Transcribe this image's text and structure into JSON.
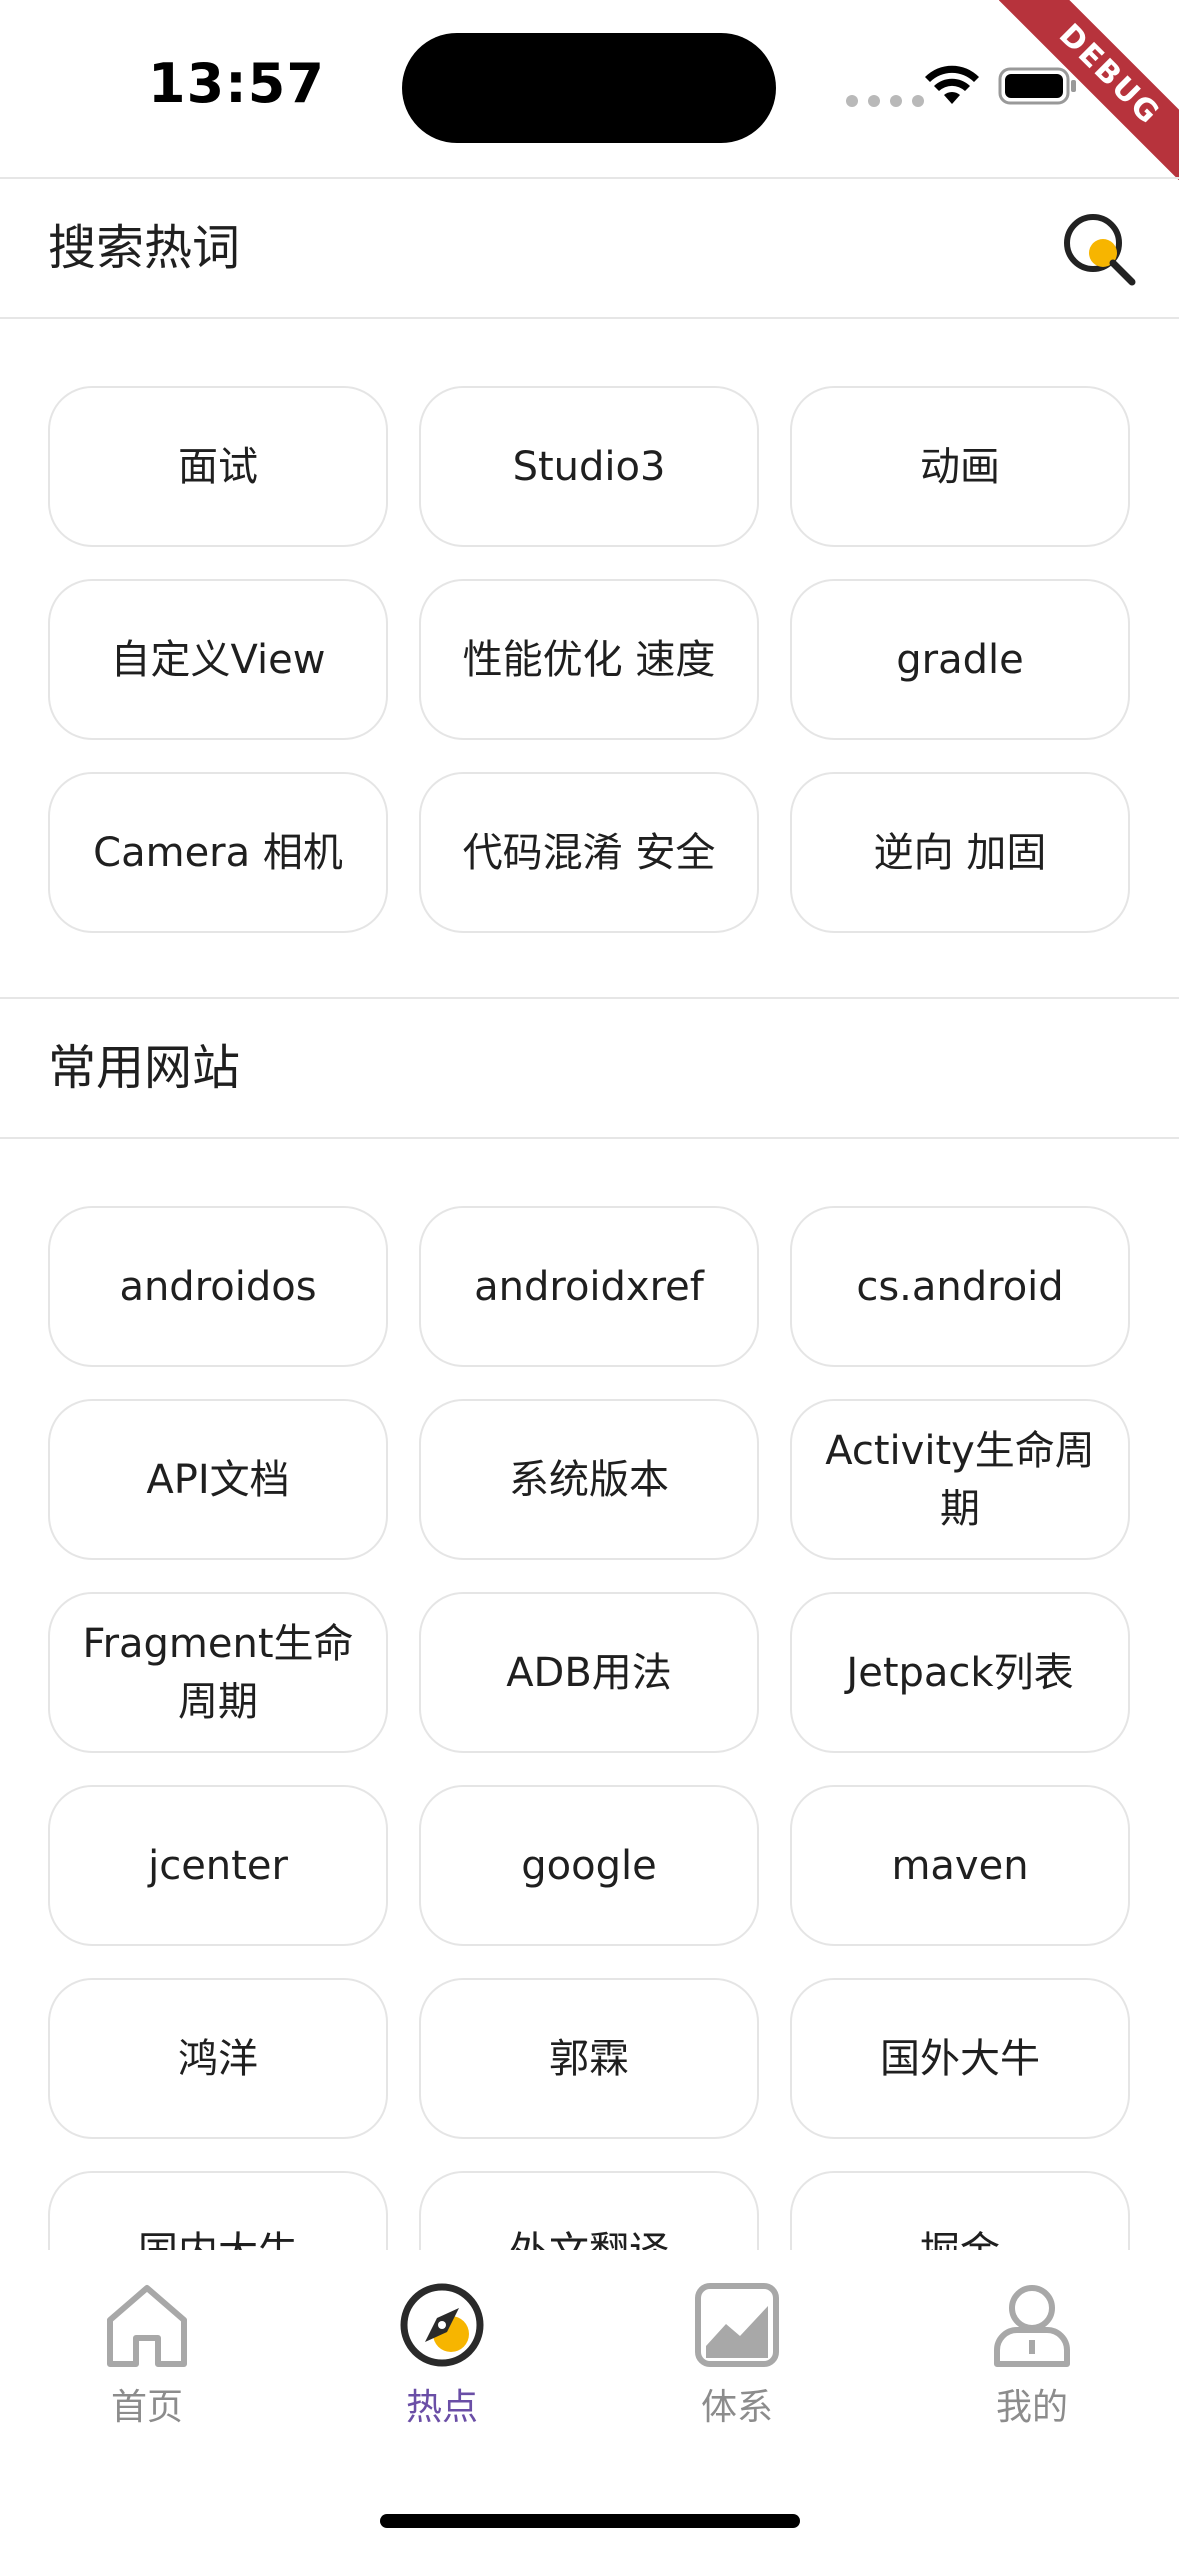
{
  "status_bar": {
    "time": "13:57",
    "debug_label": "DEBUG"
  },
  "hot_words": {
    "title": "搜索热词",
    "items": [
      "面试",
      "Studio3",
      "动画",
      "自定义View",
      "性能优化 速度",
      "gradle",
      "Camera 相机",
      "代码混淆 安全",
      "逆向 加固"
    ]
  },
  "websites": {
    "title": "常用网站",
    "items": [
      "androidos",
      "androidxref",
      "cs.android",
      "API文档",
      "系统版本",
      "Activity生命周期",
      "Fragment生命周期",
      "ADB用法",
      "Jetpack列表",
      "jcenter",
      "google",
      "maven",
      "鸿洋",
      "郭霖",
      "国外大牛",
      "国内大牛",
      "外文翻译",
      "掘金"
    ]
  },
  "bottom_nav": {
    "items": [
      {
        "label": "首页",
        "icon": "home-icon",
        "active": false
      },
      {
        "label": "热点",
        "icon": "compass-icon",
        "active": true
      },
      {
        "label": "体系",
        "icon": "chart-icon",
        "active": false
      },
      {
        "label": "我的",
        "icon": "user-icon",
        "active": false
      }
    ]
  },
  "colors": {
    "accent": "#6a4ea6",
    "highlight": "#f7b500",
    "inactive": "#8c8c8c",
    "border": "#e5e5e5"
  }
}
